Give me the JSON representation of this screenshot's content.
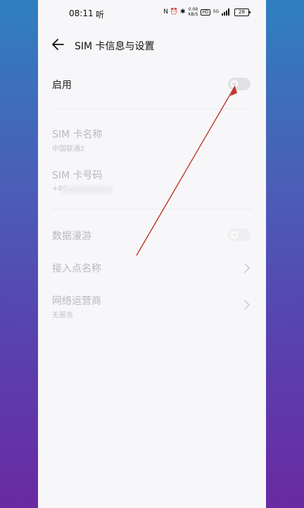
{
  "status_bar": {
    "time": "08:11",
    "speaker_char": "听",
    "status_icons": "N ⏰ ✱",
    "net_speed_value": "0.09",
    "net_speed_unit": "KB/S",
    "volte_label": "HD",
    "signal_label": "5G",
    "battery_level": "28"
  },
  "header": {
    "title": "SIM 卡信息与设置"
  },
  "enable": {
    "label": "启用",
    "toggle_on": false
  },
  "sim_name": {
    "label": "SIM 卡名称",
    "value": "中国联通2"
  },
  "sim_number": {
    "label": "SIM 卡号码",
    "value": "+86"
  },
  "data_roaming": {
    "label": "数据漫游",
    "toggle_on": false
  },
  "apn": {
    "label": "接入点名称"
  },
  "carrier": {
    "label": "网络运营商",
    "value": "无服务"
  },
  "colors": {
    "annotation": "#c0392b",
    "page_bg": "#f7f7f9"
  }
}
